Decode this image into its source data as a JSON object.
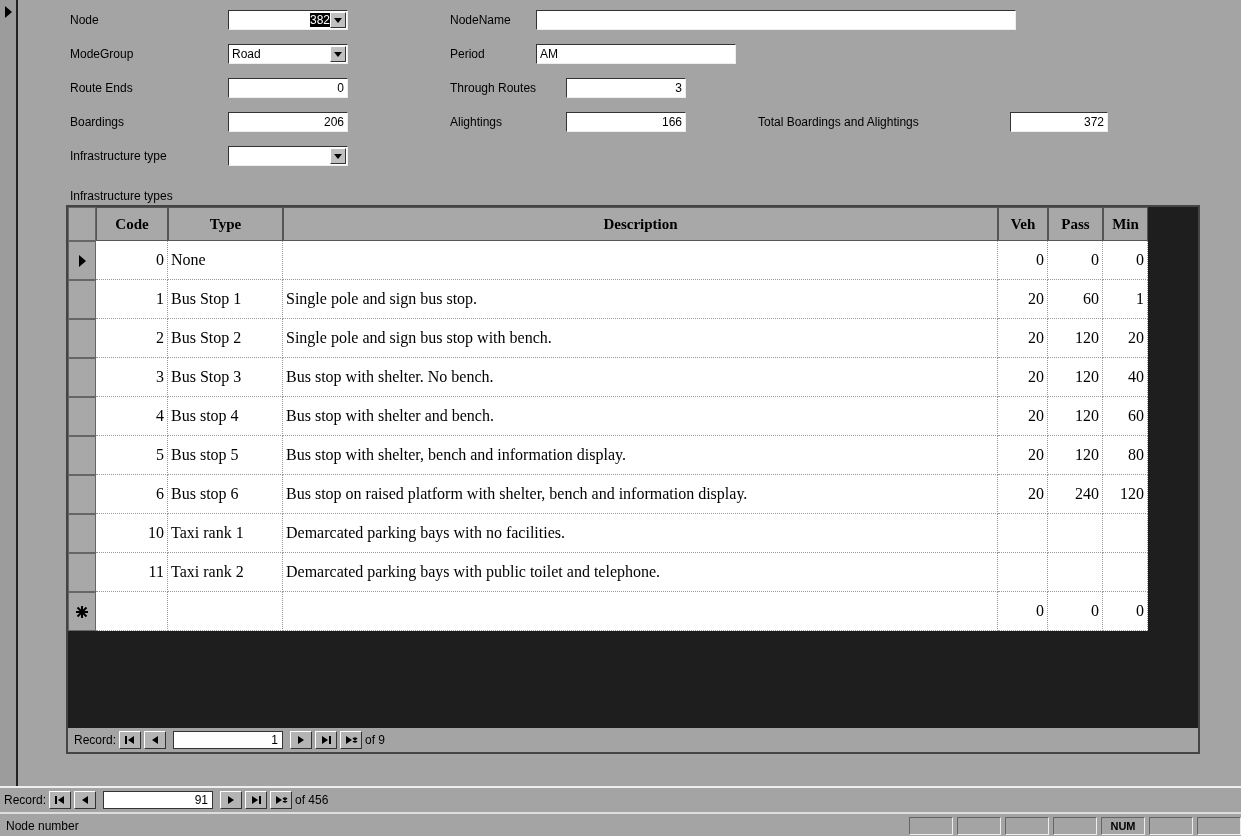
{
  "form": {
    "rows": [
      [
        {
          "label": "Node",
          "kind": "number-combo",
          "value": "382",
          "highlighted": true
        },
        {
          "label": "NodeName",
          "kind": "text"
        }
      ],
      [
        {
          "label": "ModeGroup",
          "kind": "text-combo",
          "value": "Road"
        },
        {
          "label": "Period",
          "kind": "text",
          "value": "AM"
        }
      ],
      [
        {
          "label": "Route Ends",
          "kind": "number",
          "value": "0"
        },
        {
          "label": "Through Routes",
          "kind": "number",
          "value": "3"
        }
      ],
      [
        {
          "label": "Boardings",
          "kind": "number",
          "value": "206"
        },
        {
          "label": "Alightings",
          "kind": "number",
          "value": "166"
        },
        {
          "label": "Total Boardings and  Alightings",
          "kind": "number",
          "value": "372"
        }
      ],
      [
        {
          "label": "Infrastructure type",
          "kind": "number-combo"
        }
      ]
    ]
  },
  "subform": {
    "label": "Infrastructure types",
    "table": {
      "columns": [
        "Code",
        "Type",
        "Description",
        "Veh",
        "Pass",
        "Min"
      ],
      "rows": [
        {
          "kind": "record",
          "selected": true,
          "cells": [
            "0",
            "None",
            null,
            "0",
            "0",
            "0"
          ]
        },
        {
          "kind": "record",
          "selected": false,
          "cells": [
            "1",
            "Bus Stop 1",
            "Single pole and sign bus stop.",
            "20",
            "60",
            "1"
          ]
        },
        {
          "kind": "record",
          "selected": false,
          "cells": [
            "2",
            "Bus Stop 2",
            "Single pole and sign bus stop with bench.",
            "20",
            "120",
            "20"
          ]
        },
        {
          "kind": "record",
          "selected": false,
          "cells": [
            "3",
            "Bus Stop 3",
            "Bus stop with shelter.  No bench.",
            "20",
            "120",
            "40"
          ]
        },
        {
          "kind": "record",
          "selected": false,
          "cells": [
            "4",
            "Bus stop 4",
            "Bus stop with shelter and bench.",
            "20",
            "120",
            "60"
          ]
        },
        {
          "kind": "record",
          "selected": false,
          "cells": [
            "5",
            "Bus stop 5",
            "Bus stop with shelter, bench and information display.",
            "20",
            "120",
            "80"
          ]
        },
        {
          "kind": "record",
          "selected": false,
          "cells": [
            "6",
            "Bus stop 6",
            "Bus stop on raised platform with shelter, bench and information display.",
            "20",
            "240",
            "120"
          ]
        },
        {
          "kind": "record",
          "selected": false,
          "cells": [
            "10",
            "Taxi rank 1",
            "Demarcated parking bays with no facilities.",
            null,
            null,
            null
          ]
        },
        {
          "kind": "record",
          "selected": false,
          "cells": [
            "11",
            "Taxi rank 2",
            "Demarcated parking bays with public toilet and telephone.",
            null,
            null,
            null
          ]
        },
        {
          "kind": "new",
          "selected": false,
          "cells": [
            null,
            null,
            null,
            "0",
            "0",
            "0"
          ]
        }
      ]
    },
    "navigator": {
      "label": "Record:",
      "current": "1",
      "total": "of 9"
    }
  },
  "navigator": {
    "label": "Record:",
    "current": "91",
    "total": "of 456"
  },
  "status_bar": {
    "text": "Node number",
    "indicators": [
      "NUM"
    ]
  }
}
